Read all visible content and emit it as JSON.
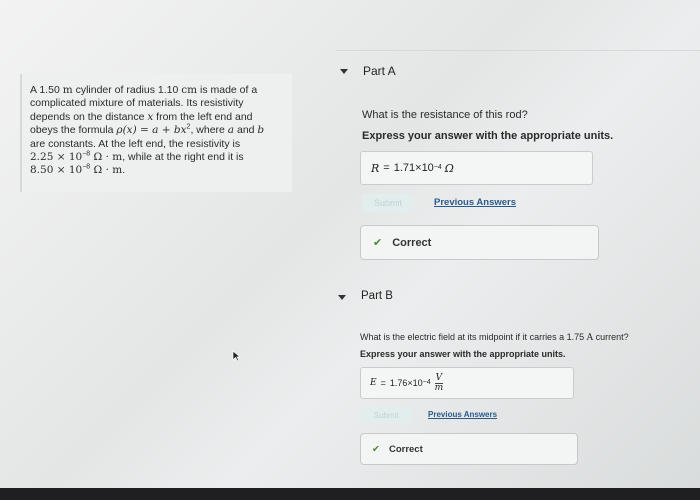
{
  "problem": {
    "line1_a": "A 1.50 ",
    "line1_unit": "m",
    "line1_b": " cylinder of radius 1.10 ",
    "line1_unit2": "cm",
    "line1_c": " is made of a",
    "line2": "complicated mixture of materials. Its resistivity",
    "line3_a": "depends on the distance ",
    "line3_var": "x",
    "line3_b": " from the left end and",
    "line4_a": "obeys the formula ",
    "line4_formula": "ρ(x) = a + bx",
    "line4_exp": "2",
    "line4_b": ", where ",
    "line4_a_var": "a",
    "line4_and": " and ",
    "line4_b_var": "b",
    "line5": "are constants. At the left end, the resistivity is",
    "line6_val": "2.25 × 10",
    "line6_exp": "−8",
    "line6_unit": " Ω · m",
    "line6_b": ", while at the right end it is",
    "line7_val": "8.50 × 10",
    "line7_exp": "−8",
    "line7_unit": " Ω · m",
    "line7_end": "."
  },
  "partA": {
    "title": "Part A",
    "question": "What is the resistance of this rod?",
    "instruction": "Express your answer with the appropriate units.",
    "answer_lhs": "R",
    "answer_eq": "=",
    "answer_value": "1.71×10",
    "answer_exp": "−4",
    "answer_unit": "Ω",
    "submit_label": "Submit",
    "previous_answers": "Previous Answers",
    "correct_label": "Correct"
  },
  "partB": {
    "title": "Part B",
    "question_a": "What is the electric field at its midpoint if it carries a 1.75 ",
    "question_unit": "A",
    "question_b": " current?",
    "instruction": "Express your answer with the appropriate units.",
    "answer_lhs": "E",
    "answer_eq": "=",
    "answer_value": "1.76×10",
    "answer_exp": "−4",
    "answer_unit_num": "V",
    "answer_unit_den": "m",
    "submit_label": "Submit",
    "previous_answers": "Previous Answers",
    "correct_label": "Correct"
  }
}
